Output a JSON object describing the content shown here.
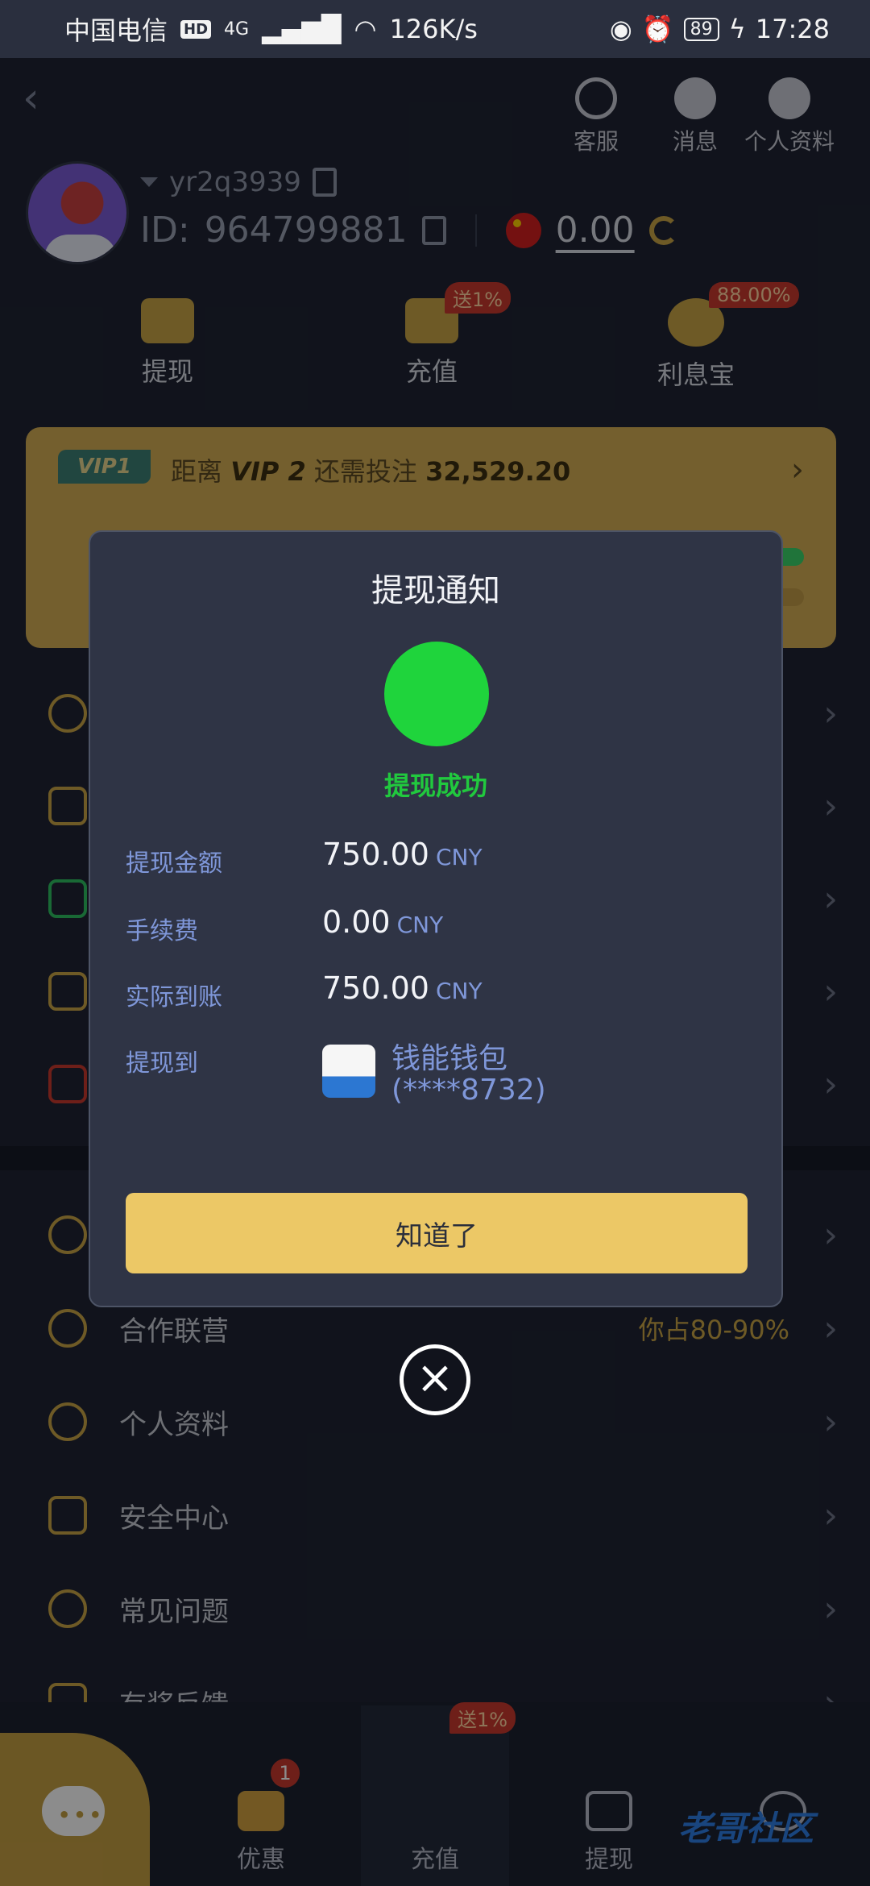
{
  "status_bar": {
    "carrier": "中国电信",
    "hd": "HD",
    "network": "4G",
    "speed": "126K/s",
    "battery": "89",
    "time": "17:28"
  },
  "header": {
    "back_icon": "back-chevron",
    "service_label": "客服",
    "messages_label": "消息",
    "profile_label": "个人资料"
  },
  "profile": {
    "username": "yr2q3939",
    "id_label": "ID:",
    "id_value": "964799881",
    "balance": "0.00"
  },
  "quick_actions": {
    "withdraw_label": "提现",
    "deposit_label": "充值",
    "deposit_badge": "送1%",
    "interest_label": "利息宝",
    "interest_badge": "88.00%"
  },
  "vip": {
    "level_tag": "VIP1",
    "progress_prefix": "距离",
    "next_level": "VIP 2",
    "progress_middle": "还需投注",
    "amount_needed": "32,529.20"
  },
  "menu": {
    "affiliate_label": "合作联营",
    "affiliate_value": "你占80-90%",
    "profile_label": "个人资料",
    "security_label": "安全中心",
    "faq_label": "常见问题",
    "feedback_label": "有奖反馈"
  },
  "bottom_nav": {
    "promo_label": "优惠",
    "promo_badge": "1",
    "deposit_label": "充值",
    "deposit_badge": "送1%",
    "withdraw_label": "提现"
  },
  "watermark_text": "老哥社区",
  "dialog": {
    "title": "提现通知",
    "status": "提现成功",
    "status_color": "#1fd43c",
    "amount_label": "提现金额",
    "amount_value": "750.00",
    "fee_label": "手续费",
    "fee_value": "0.00",
    "received_label": "实际到账",
    "received_value": "750.00",
    "currency": "CNY",
    "destination_label": "提现到",
    "wallet_name": "钱能钱包",
    "wallet_account": "(****8732)",
    "confirm_button": "知道了"
  },
  "colors": {
    "background": "#1f2433",
    "accent_gold": "#c9a446",
    "button_gold": "#ecc866",
    "badge_red": "#c9392e",
    "label_blue": "#7f97d9"
  }
}
